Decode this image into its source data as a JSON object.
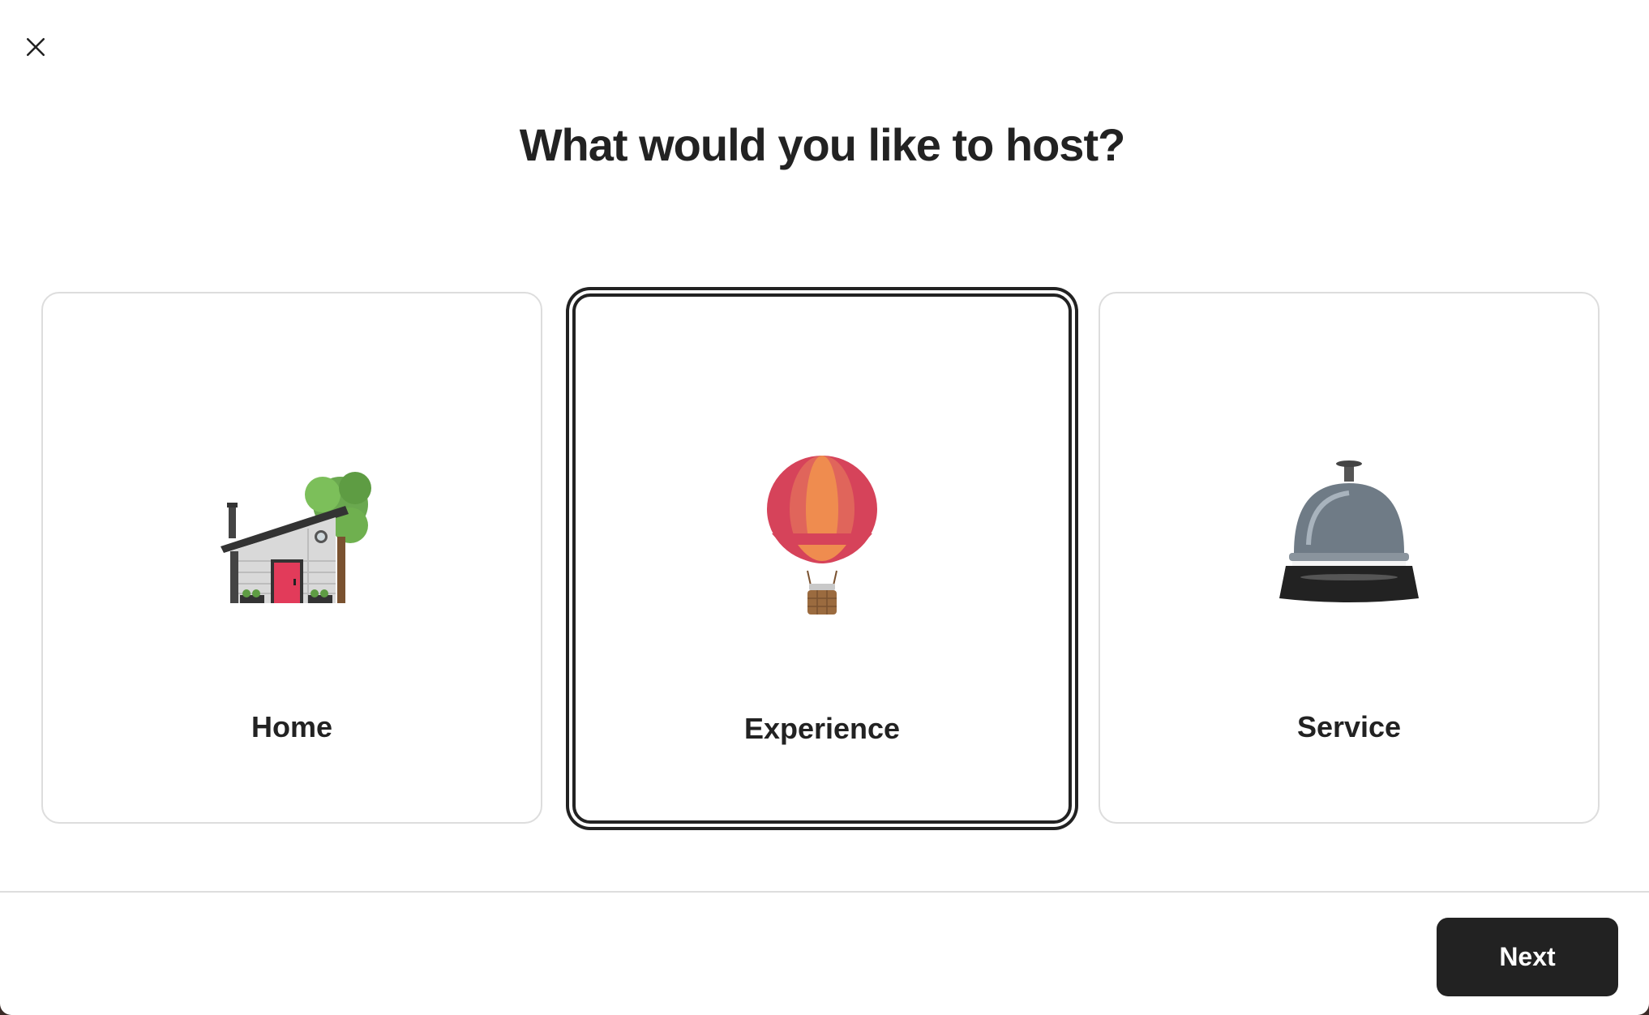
{
  "modal": {
    "title": "What would you like to host?",
    "close_icon": "close-icon"
  },
  "options": [
    {
      "label": "Home",
      "icon": "house-icon",
      "selected": false
    },
    {
      "label": "Experience",
      "icon": "hot-air-balloon-icon",
      "selected": true
    },
    {
      "label": "Service",
      "icon": "service-bell-icon",
      "selected": false
    }
  ],
  "footer": {
    "next_label": "Next"
  },
  "colors": {
    "text": "#222222",
    "border": "#dddddd",
    "button_bg": "#222222",
    "button_text": "#ffffff"
  }
}
